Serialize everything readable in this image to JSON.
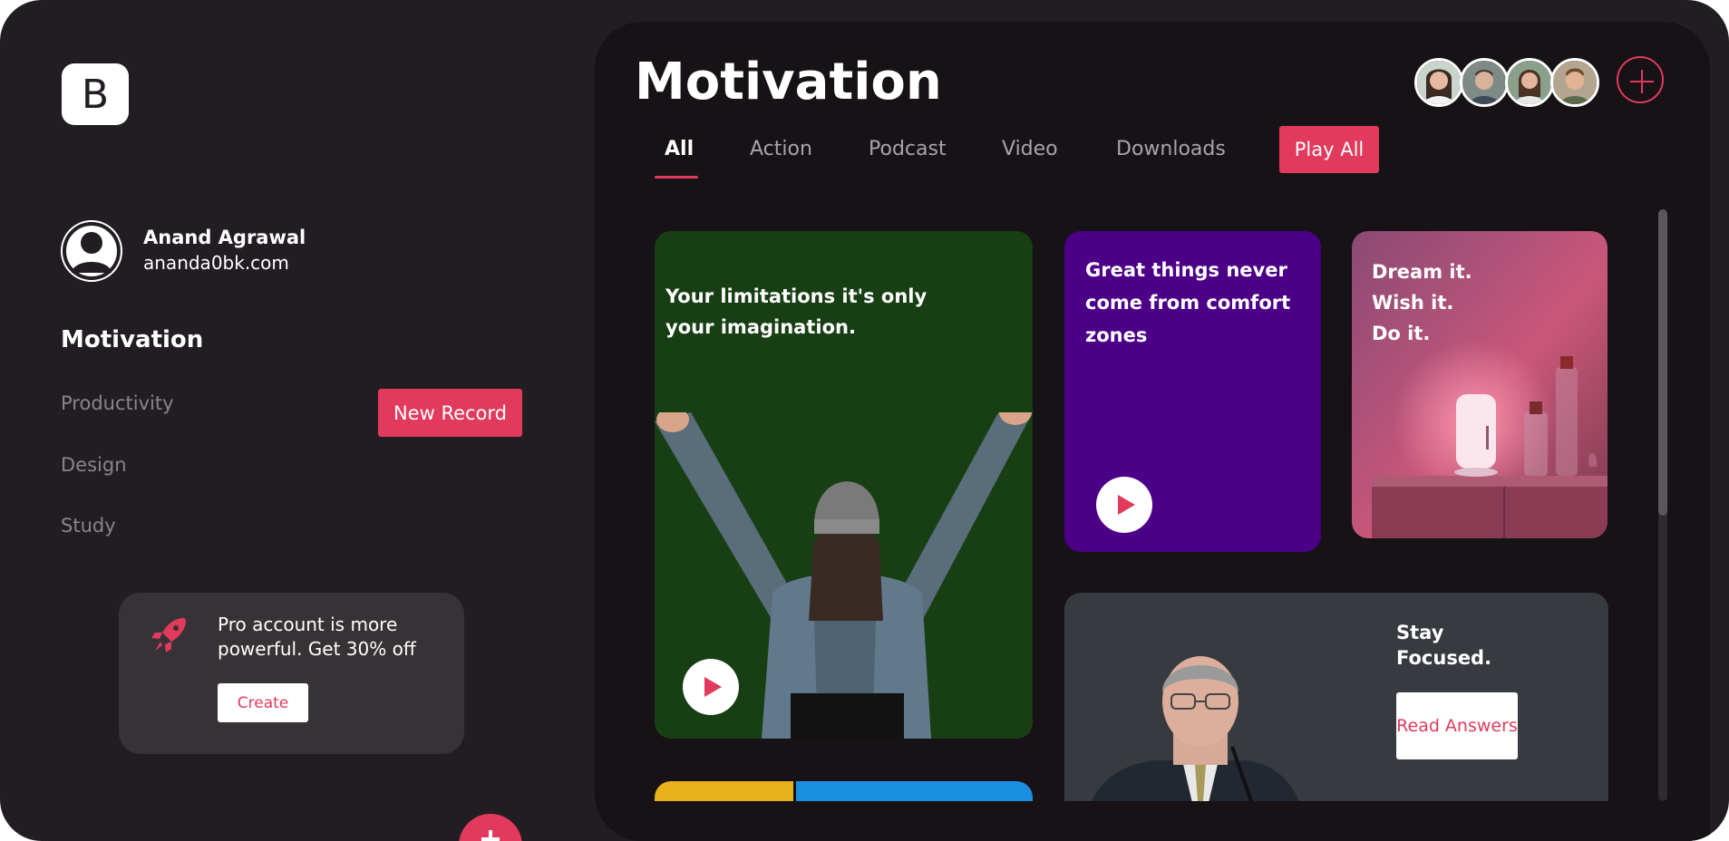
{
  "brand": {
    "logo_letter": "B"
  },
  "user": {
    "name": "Anand Agrawal",
    "email": "ananda0bk.com"
  },
  "sidebar": {
    "heading": "Motivation",
    "items": [
      {
        "label": "Productivity"
      },
      {
        "label": "Design"
      },
      {
        "label": "Study"
      }
    ],
    "new_record_label": "New Record"
  },
  "promo": {
    "text": "Pro account is more powerful. Get 30% off",
    "button_label": "Create",
    "icon": "rocket-icon"
  },
  "main": {
    "title": "Motivation",
    "tabs": [
      {
        "label": "All",
        "active": true
      },
      {
        "label": "Action"
      },
      {
        "label": "Podcast"
      },
      {
        "label": "Video"
      },
      {
        "label": "Downloads"
      }
    ],
    "play_all_label": "Play All",
    "team_avatars": 4
  },
  "cards": {
    "limitations": {
      "text": "Your limitations it's only your imagination.",
      "bg": "#183f14"
    },
    "comfort": {
      "text": "Great things never come from comfort zones",
      "bg": "#4b0087"
    },
    "dream": {
      "lines": [
        "Dream it.",
        "Wish it.",
        "Do it."
      ]
    },
    "focused": {
      "text": "Stay Focused.",
      "button_label": "Read Answers",
      "bg": "#373a3f"
    }
  },
  "colors": {
    "accent": "#e23a5d",
    "app_bg": "#221d22",
    "panel_bg": "#161216"
  }
}
